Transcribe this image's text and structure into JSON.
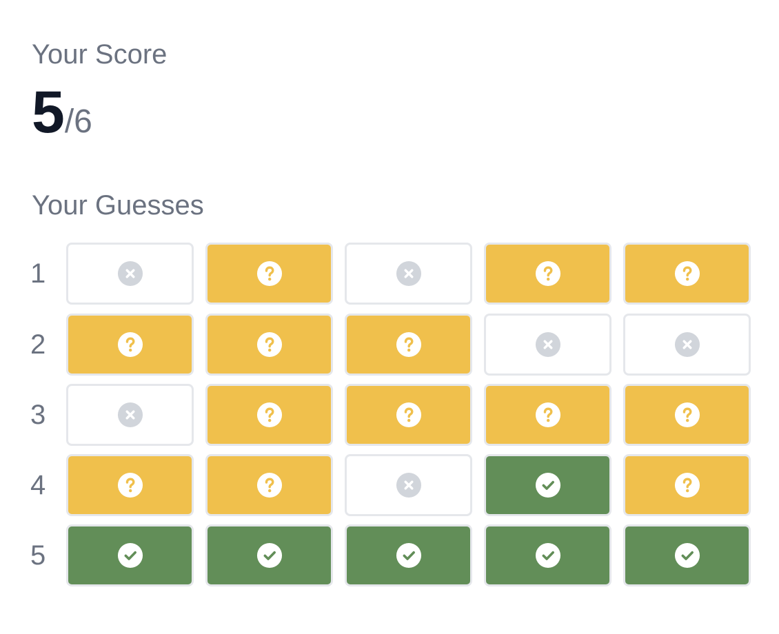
{
  "score": {
    "label": "Your Score",
    "value": "5",
    "total": "/6"
  },
  "guesses": {
    "label": "Your Guesses",
    "rows": [
      {
        "number": "1",
        "cells": [
          "miss",
          "partial",
          "miss",
          "partial",
          "partial"
        ]
      },
      {
        "number": "2",
        "cells": [
          "partial",
          "partial",
          "partial",
          "miss",
          "miss"
        ]
      },
      {
        "number": "3",
        "cells": [
          "miss",
          "partial",
          "partial",
          "partial",
          "partial"
        ]
      },
      {
        "number": "4",
        "cells": [
          "partial",
          "partial",
          "miss",
          "correct",
          "partial"
        ]
      },
      {
        "number": "5",
        "cells": [
          "correct",
          "correct",
          "correct",
          "correct",
          "correct"
        ]
      }
    ]
  },
  "icons": {
    "miss": "x-circle-icon",
    "partial": "question-circle-icon",
    "correct": "check-circle-icon"
  },
  "colors": {
    "partial": "#f0c04c",
    "correct": "#628e58",
    "miss_icon": "#d1d5db",
    "border": "#e5e7eb"
  }
}
